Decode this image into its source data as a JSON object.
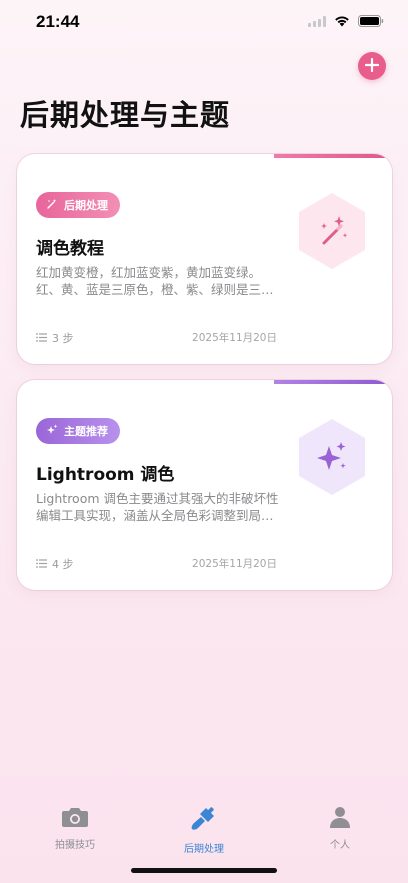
{
  "status_bar": {
    "time": "21:44"
  },
  "header": {
    "title": "后期处理与主题",
    "add_icon": "plus-icon"
  },
  "cards": [
    {
      "badge": "后期处理",
      "badge_icon": "magic-wand-icon",
      "title": "调色教程",
      "description": "红加黄变橙，红加蓝变紫，黄加蓝变绿。红、黄、蓝是三原色，橙、紫、绿则是三间色。",
      "steps": "3 步",
      "date": "2025年11月20日",
      "accent_color": "#e8609a",
      "hex_icon": "magic-wand-sparkles-icon"
    },
    {
      "badge": "主题推荐",
      "badge_icon": "sparkles-icon",
      "title": "Lightroom 调色",
      "description": "Lightroom 调色主要通过其强大的非破坏性编辑工具实现，涵盖从全局色彩调整到局部精细修饰的各个方面。",
      "steps": "4 步",
      "date": "2025年11月20日",
      "accent_color": "#9b6ad6",
      "hex_icon": "sparkles-icon"
    }
  ],
  "tab_bar": {
    "items": [
      {
        "label": "拍摄技巧",
        "icon": "camera-icon",
        "active": false
      },
      {
        "label": "后期处理",
        "icon": "brush-icon",
        "active": true
      },
      {
        "label": "个人",
        "icon": "person-icon",
        "active": false
      }
    ]
  }
}
